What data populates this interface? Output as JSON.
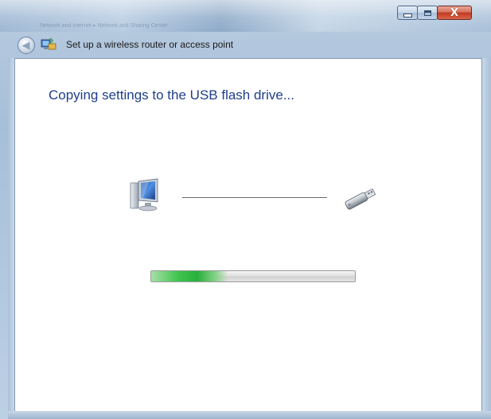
{
  "window": {
    "address_ghost": "Network and Internet ▸ Network and Sharing Center",
    "caption": {
      "minimize_icon": "minimize-icon",
      "maximize_icon": "maximize-icon",
      "close_glyph": "X"
    }
  },
  "nav": {
    "back_icon": "back-arrow-icon",
    "back_glyph": "◀",
    "wizard_icon": "network-setup-icon",
    "title": "Set up a wireless router or access point"
  },
  "content": {
    "heading": "Copying settings to the USB flash drive...",
    "source_icon": "computer-icon",
    "target_icon": "usb-flash-drive-icon",
    "progress_percent": 38
  },
  "colors": {
    "heading": "#1e3f8a",
    "progress_fill": "#28b03c",
    "close_button": "#c0391f"
  }
}
